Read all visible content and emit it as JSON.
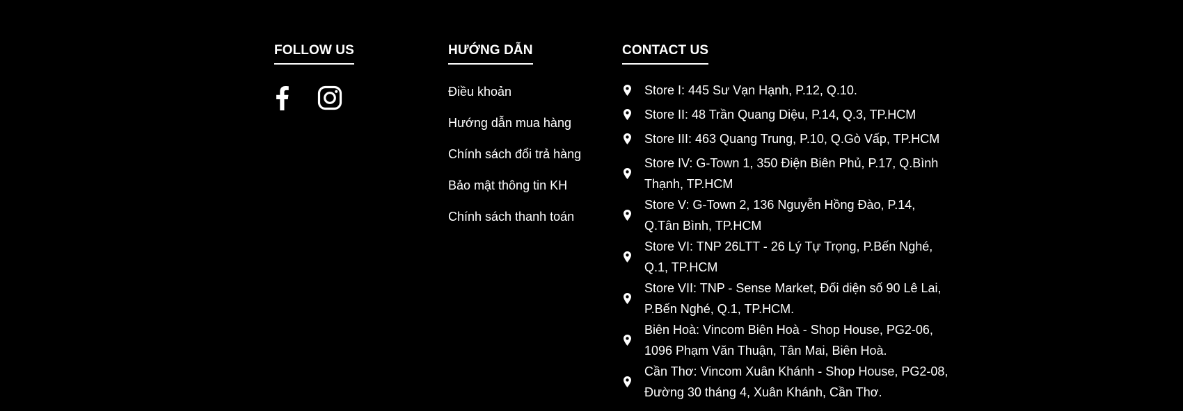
{
  "follow": {
    "heading": "FOLLOW US",
    "icons": [
      "facebook-icon",
      "instagram-icon"
    ]
  },
  "guide": {
    "heading": "HƯỚNG DẪN",
    "links": [
      "Điều khoản",
      "Hướng dẫn mua hàng",
      "Chính sách đổi trả hàng",
      "Bảo mật thông tin KH",
      "Chính sách thanh toán"
    ]
  },
  "contact": {
    "heading": "CONTACT US",
    "icon": "map-pin-icon",
    "stores": [
      "Store I: 445 Sư Vạn Hạnh, P.12, Q.10.",
      "Store II: 48 Trần Quang Diệu, P.14, Q.3, TP.HCM",
      "Store III: 463 Quang Trung, P.10, Q.Gò Vấp, TP.HCM",
      "Store IV: G-Town 1, 350 Điện Biên Phủ, P.17, Q.Bình Thạnh, TP.HCM",
      "Store V: G-Town 2, 136 Nguyễn Hồng Đào, P.14, Q.Tân Bình, TP.HCM",
      "Store VI: TNP 26LTT - 26 Lý Tự Trọng, P.Bến Nghé, Q.1, TP.HCM",
      "Store VII: TNP - Sense Market, Đối diện số 90 Lê Lai, P.Bến Nghé, Q.1, TP.HCM.",
      "Biên Hoà: Vincom Biên Hoà - Shop House, PG2-06, 1096 Phạm Văn Thuận, Tân Mai, Biên Hoà.",
      "Cần Thơ: Vincom Xuân Khánh - Shop House, PG2-08, Đường 30 tháng 4, Xuân Khánh, Cần Thơ."
    ]
  },
  "colors": {
    "background": "#000000",
    "text": "#ffffff"
  }
}
